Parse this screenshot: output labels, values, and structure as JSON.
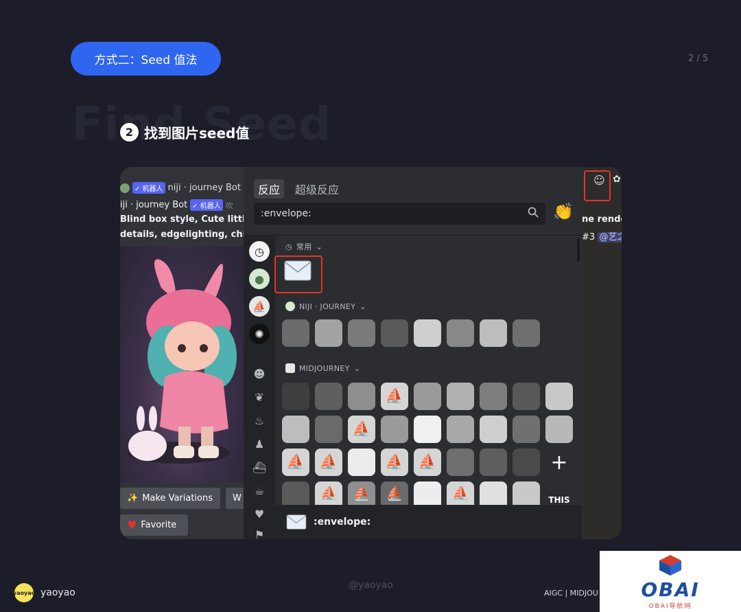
{
  "slide": {
    "pill_label": "方式二：Seed 值法",
    "page_number": "2 / 5",
    "background_title": "Find Seed",
    "step_number": "2",
    "step_title": "找到图片seed值"
  },
  "chat": {
    "line1_name": "niji · journey Bot B",
    "line1_tag": "✓ 机器人",
    "line2_name": "iji · journey Bot",
    "line2_tag": "✓ 机器人",
    "line2_suffix": "吹",
    "line3": "Blind box style, Cute little",
    "line4": "details, edgelighting, chibi",
    "button_make_variations": "Make Variations",
    "button_w": "W",
    "button_favorite": "Favorite"
  },
  "right": {
    "line1": "ne rende",
    "line2_prefix": "#3",
    "line2_mention": "@艺之"
  },
  "picker": {
    "tab_reactions": "反应",
    "tab_super_reactions": "超级反应",
    "search_value": ":envelope:",
    "frequent_label": "常用",
    "niji_label": "NIJI · JOURNEY",
    "midjourney_label": "MIDJOURNEY",
    "footer_emoji_name": ":envelope:",
    "plus_sign": "+",
    "this_text": "THIS"
  },
  "brand": {
    "name": "yaoyao",
    "logo_text": "yaoyao",
    "watermark": "@yaoyao",
    "footer_right": "AIGC | MIDJOU",
    "obai": "OBAI",
    "obai_sub": "OBAI导航网"
  },
  "colors": {
    "page_bg": "#1c1d29",
    "pill_bg": "#2f66f0",
    "highlight": "#e0372a",
    "discord_panel": "#2b2d31",
    "bot_tag": "#5865f2"
  }
}
